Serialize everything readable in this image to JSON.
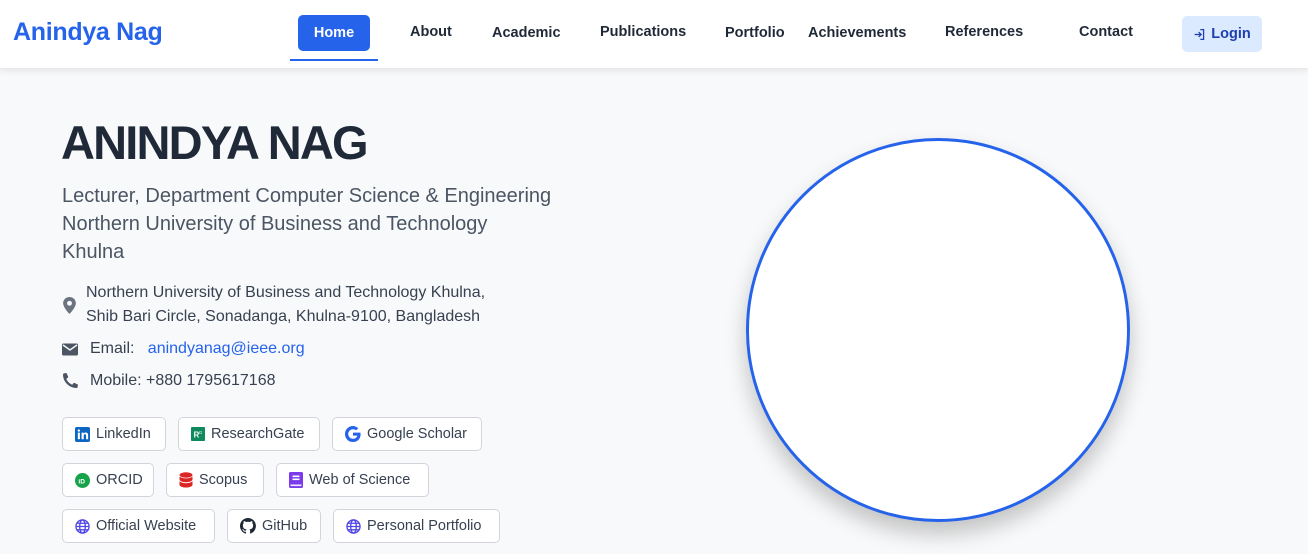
{
  "brand": "Anindya Nag",
  "nav": {
    "home": "Home",
    "about": "About",
    "academic": "Academic",
    "publications": "Publications",
    "portfolio": "Portfolio",
    "achievements": "Achievements",
    "references": "References",
    "contact": "Contact",
    "login": "Login"
  },
  "profile": {
    "name": "ANINDYA NAG",
    "subtitle_line1": "Lecturer, Department Computer Science & Engineering",
    "subtitle_line2": "Northern University of Business and Technology",
    "subtitle_line3": "Khulna",
    "address_line1": "Northern University of Business and Technology Khulna,",
    "address_line2": "Shib Bari Circle, Sonadanga, Khulna-9100, Bangladesh",
    "email_label": "Email:",
    "email": "anindyanag@ieee.org",
    "mobile": "Mobile: +880 1795617168"
  },
  "links": {
    "linkedin": "LinkedIn",
    "researchgate": "ResearchGate",
    "google_scholar": "Google Scholar",
    "orcid": "ORCID",
    "scopus": "Scopus",
    "web_of_science": "Web of Science",
    "official_website": "Official Website",
    "github": "GitHub",
    "personal_portfolio": "Personal Portfolio"
  },
  "colors": {
    "accent": "#2563eb",
    "text_dark": "#1f2937",
    "login_bg": "#dbeafe"
  },
  "icons": [
    "map-pin-icon",
    "envelope-icon",
    "phone-icon",
    "login-icon",
    "linkedin-icon",
    "researchgate-icon",
    "google-icon",
    "orcid-icon",
    "database-icon",
    "book-icon",
    "globe-icon",
    "github-icon"
  ]
}
